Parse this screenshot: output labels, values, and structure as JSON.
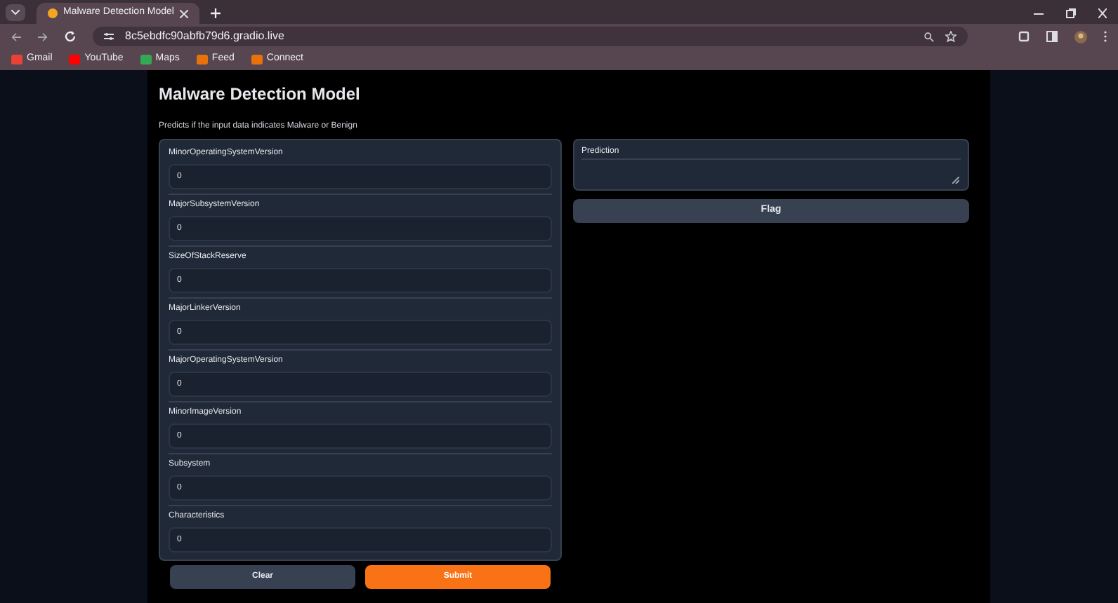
{
  "browser": {
    "tab_title": "Malware Detection Model",
    "url": "8c5ebdfc90abfb79d6.gradio.live",
    "bookmarks": [
      {
        "label": "Gmail",
        "color": "#ea4335"
      },
      {
        "label": "YouTube",
        "color": "#ff0000"
      },
      {
        "label": "Maps",
        "color": "#34a853"
      },
      {
        "label": "Feed",
        "color": "#e8710a"
      },
      {
        "label": "Connect",
        "color": "#e8710a"
      }
    ]
  },
  "app": {
    "title": "Malware Detection Model",
    "description": "Predicts if the input data indicates Malware or Benign",
    "inputs": [
      {
        "label": "MinorOperatingSystemVersion",
        "value": "0"
      },
      {
        "label": "MajorSubsystemVersion",
        "value": "0"
      },
      {
        "label": "SizeOfStackReserve",
        "value": "0"
      },
      {
        "label": "MajorLinkerVersion",
        "value": "0"
      },
      {
        "label": "MajorOperatingSystemVersion",
        "value": "0"
      },
      {
        "label": "MinorImageVersion",
        "value": "0"
      },
      {
        "label": "Subsystem",
        "value": "0"
      },
      {
        "label": "Characteristics",
        "value": "0"
      }
    ],
    "buttons": [
      {
        "label": "Clear",
        "kind": "secondary"
      },
      {
        "label": "Submit",
        "kind": "primary"
      }
    ],
    "output": {
      "label": "Prediction"
    },
    "flag_button": {
      "label": "Flag",
      "kind": "secondary"
    }
  }
}
